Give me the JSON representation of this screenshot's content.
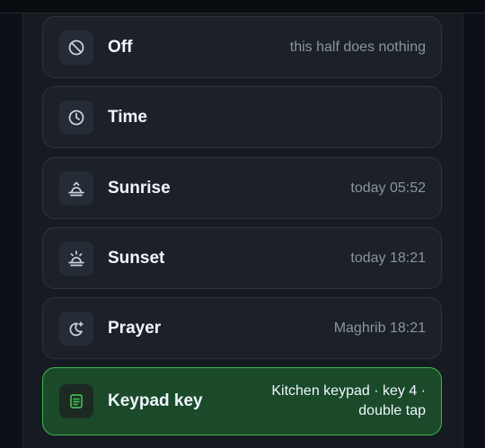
{
  "options": [
    {
      "label": "Off",
      "hint": "this half does nothing",
      "icon": "ban-icon"
    },
    {
      "label": "Time",
      "hint": "",
      "icon": "clock-icon"
    },
    {
      "label": "Sunrise",
      "hint": "today 05:52",
      "icon": "sunrise-icon"
    },
    {
      "label": "Sunset",
      "hint": "today 18:21",
      "icon": "sunset-icon"
    },
    {
      "label": "Prayer",
      "hint": "Maghrib 18:21",
      "icon": "moon-star-icon"
    },
    {
      "label": "Keypad key",
      "hint_line1": "Kitchen keypad · key 4 ·",
      "hint_line2": "double tap",
      "icon": "keypad-icon",
      "selected": true
    }
  ],
  "colors": {
    "accent": "#3fb950",
    "selected_bg": "#1a4a2a",
    "card_bg": "#1c2128",
    "text": "#f0f6fc",
    "muted": "#8b949e"
  }
}
